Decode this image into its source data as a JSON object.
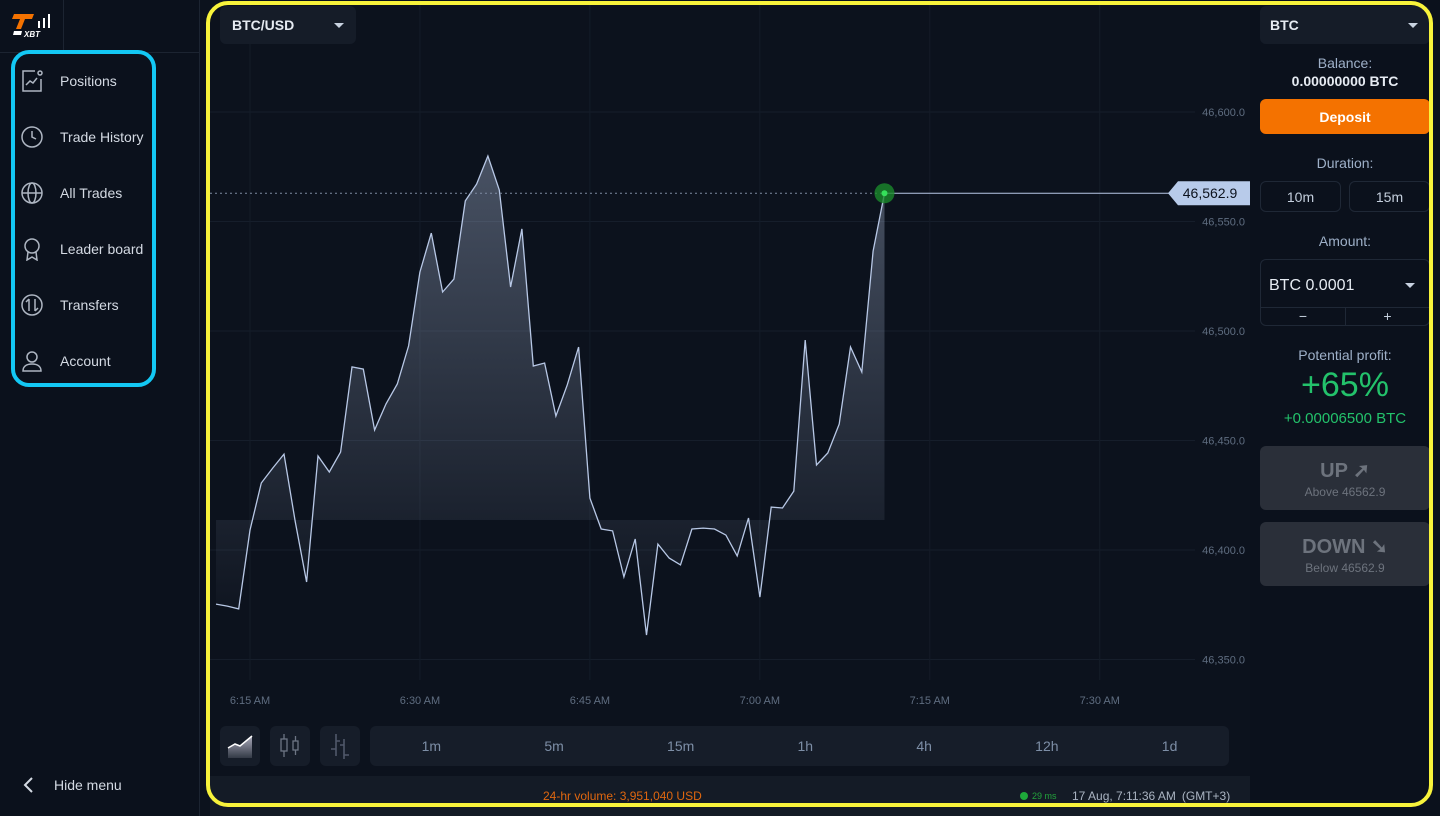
{
  "logo": {
    "text": "XBT",
    "accent": "#f47200"
  },
  "sidebar": {
    "items": [
      {
        "label": "Positions",
        "icon": "chart-icon"
      },
      {
        "label": "Trade History",
        "icon": "clock-icon"
      },
      {
        "label": "All Trades",
        "icon": "globe-icon"
      },
      {
        "label": "Leader board",
        "icon": "award-icon"
      },
      {
        "label": "Transfers",
        "icon": "transfer-icon"
      },
      {
        "label": "Account",
        "icon": "user-icon"
      }
    ],
    "hide_label": "Hide menu"
  },
  "chart": {
    "pair": "BTC/USD",
    "current_price": "46,562.9",
    "timeframes": [
      "1m",
      "5m",
      "15m",
      "1h",
      "4h",
      "12h",
      "1d"
    ],
    "chart_types": [
      "area",
      "candles",
      "bars"
    ],
    "active_chart_type": "area"
  },
  "chart_data": {
    "type": "area",
    "x_ticks": [
      "6:15 AM",
      "6:30 AM",
      "6:45 AM",
      "7:00 AM",
      "7:15 AM",
      "7:30 AM"
    ],
    "y_ticks": [
      "46,350.0",
      "46,400.0",
      "46,450.0",
      "46,500.0",
      "46,550.0",
      "46,600.0"
    ],
    "start_time": "6:12",
    "interval_minutes": 1,
    "values": [
      46375.3,
      46374.4,
      46373.1,
      46409.1,
      46430.6,
      46437.4,
      46443.8,
      46412.8,
      46385.4,
      46442.9,
      46435.6,
      46444.7,
      46483.6,
      46482.6,
      46454.8,
      46466.7,
      46475.8,
      46493.2,
      46526.9,
      46544.7,
      46517.8,
      46523.7,
      46559.4,
      46567.1,
      46579.9,
      46564.4,
      46520.1,
      46546.6,
      46484.0,
      46485.4,
      46461.2,
      46475.3,
      46492.7,
      46423.7,
      46409.6,
      46408.7,
      46387.7,
      46405.0,
      46361.2,
      46402.7,
      46396.3,
      46393.2,
      46409.6,
      46410.0,
      46409.6,
      46406.8,
      46397.3,
      46414.6,
      46378.5,
      46419.6,
      46419.2,
      46426.9,
      46495.9,
      46438.8,
      46444.3,
      46457.5,
      46492.7,
      46481.3,
      46536.5,
      46562.9
    ],
    "last_value": 46562.9,
    "grid": true,
    "line_color": "#b8c8e6"
  },
  "status": {
    "volume": "24-hr volume: 3,951,040 USD",
    "ping": "29 ms",
    "datetime": "17 Aug, 7:11:36 AM",
    "timezone": "(GMT+3)"
  },
  "panel": {
    "asset": "BTC",
    "balance_label": "Balance:",
    "balance": "0.00000000 BTC",
    "deposit": "Deposit",
    "duration_label": "Duration:",
    "durations": [
      "10m",
      "15m"
    ],
    "amount_label": "Amount:",
    "amount": "BTC 0.0001",
    "minus": "−",
    "plus": "+",
    "profit_label": "Potential profit:",
    "profit_pct": "+65%",
    "profit_btc": "+0.00006500 BTC",
    "up": {
      "label": "UP ➚",
      "sub": "Above 46562.9"
    },
    "down": {
      "label": "DOWN ➘",
      "sub": "Below 46562.9"
    }
  }
}
